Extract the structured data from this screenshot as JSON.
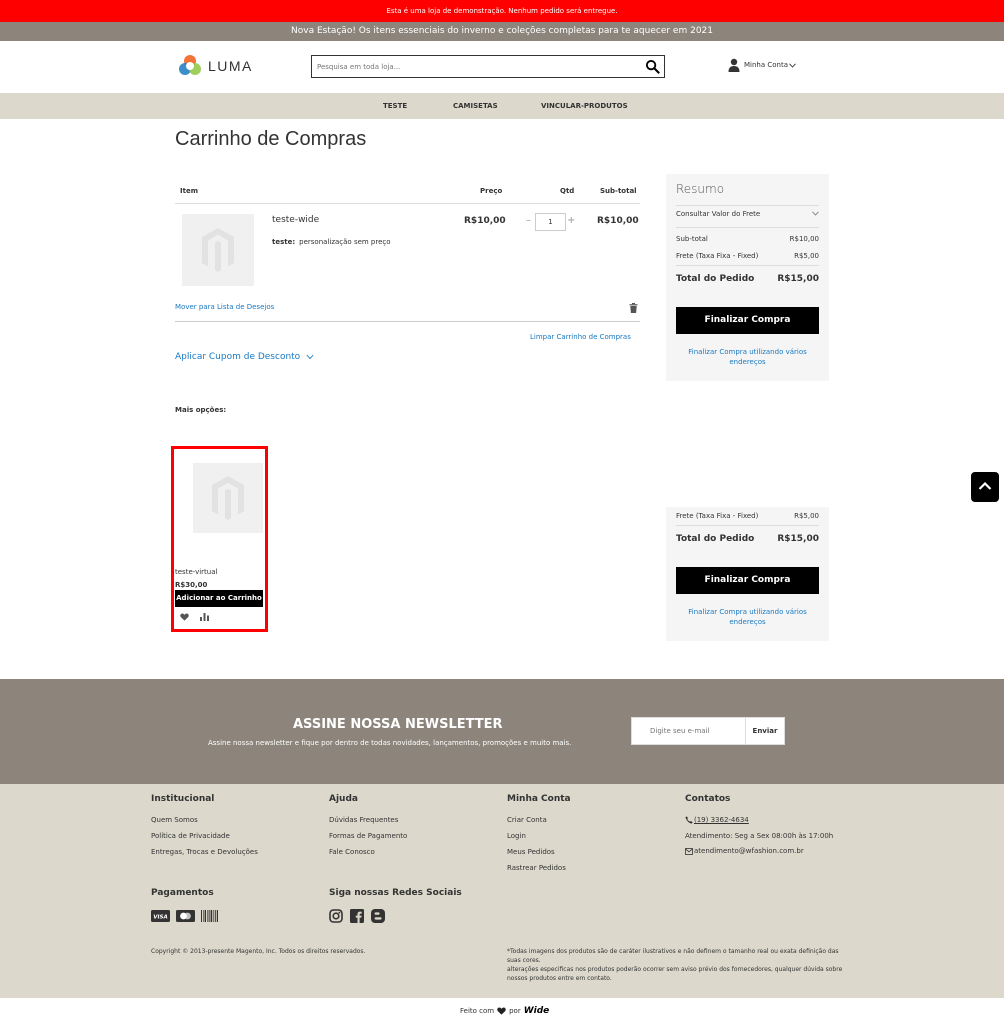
{
  "banners": {
    "demo": "Esta é uma loja de demonstração. Nenhum pedido será entregue.",
    "promo": "Nova Estação! Os itens essenciais do inverno e coleções completas para te aquecer em 2021"
  },
  "header": {
    "logo_text": "LUMA",
    "search_placeholder": "Pesquisa em toda loja...",
    "account_label": "Minha Conta"
  },
  "nav": {
    "items": [
      {
        "label": "TESTE"
      },
      {
        "label": "CAMISETAS"
      },
      {
        "label": "VINCULAR-PRODUTOS"
      }
    ]
  },
  "cart": {
    "title": "Carrinho de Compras",
    "columns": {
      "item": "Item",
      "price": "Preço",
      "qty": "Qtd",
      "subtotal": "Sub-total"
    },
    "items": [
      {
        "name": "teste-wide",
        "option_label": "teste:",
        "option_value": "personalização sem preço",
        "price": "R$10,00",
        "qty": "1",
        "subtotal": "R$10,00"
      }
    ],
    "qty_minus": "–",
    "qty_plus": "+",
    "wishlist_link": "Mover para Lista de Desejos",
    "clear_link": "Limpar Carrinho de Compras",
    "coupon_link": "Aplicar Cupom de Desconto"
  },
  "summary": {
    "title": "Resumo",
    "shipping_estimate": "Consultar Valor do Frete",
    "subtotal_label": "Sub-total",
    "subtotal_value": "R$10,00",
    "shipping_label": "Frete (Taxa Fixa - Fixed)",
    "shipping_value": "R$5,00",
    "total_label": "Total do Pedido",
    "total_value": "R$15,00",
    "checkout_button": "Finalizar Compra",
    "multi_address_link": "Finalizar Compra utilizando vários endereços"
  },
  "more_options": {
    "title": "Mais opções:",
    "products": [
      {
        "name": "teste-virtual",
        "price": "R$30,00",
        "button": "Adicionar ao Carrinho"
      }
    ]
  },
  "newsletter": {
    "title": "ASSINE NOSSA NEWSLETTER",
    "subtitle": "Assine nossa newsletter e fique por dentro de todas novidades, lançamentos, promoções e muito mais.",
    "input_placeholder": "Digite seu e-mail",
    "button": "Enviar"
  },
  "footer": {
    "institucional": {
      "title": "Institucional",
      "links": [
        "Quem Somos",
        "Política de Privacidade",
        "Entregas, Trocas e Devoluções"
      ]
    },
    "ajuda": {
      "title": "Ajuda",
      "links": [
        "Dúvidas Frequentes",
        "Formas de Pagamento",
        "Fale Conosco"
      ]
    },
    "minha_conta": {
      "title": "Minha Conta",
      "links": [
        "Criar Conta",
        "Login",
        "Meus Pedidos",
        "Rastrear Pedidos"
      ]
    },
    "contatos": {
      "title": "Contatos",
      "phone": "(19) 3362-4634",
      "hours": "Atendimento: Seg a Sex 08:00h às 17:00h",
      "email": "atendimento@wfashion.com.br"
    },
    "pagamentos": {
      "title": "Pagamentos"
    },
    "social": {
      "title": "Siga nossas Redes Sociais"
    },
    "copyright": "Copyright © 2013-presente Magento, Inc. Todos os direitos reservados.",
    "disclaimer_1": "*Todas imagens dos produtos são de caráter ilustrativos e não definem o tamanho real ou exata definição das suas cores.",
    "disclaimer_2": "alterações especificas nos produtos poderão ocorrer sem aviso prévio dos fornecedores, qualquer dúvida sobre nossos produtos entre em contato.",
    "made_with": "Feito com",
    "made_by": "por",
    "wide_logo": "Wide"
  },
  "colors": {
    "demo_bar": "#ff0000",
    "promo_bar": "#8d857c",
    "nav_bar": "#dcd8cc",
    "link": "#1979c3",
    "button": "#000000",
    "footer": "#dcd8cc"
  }
}
